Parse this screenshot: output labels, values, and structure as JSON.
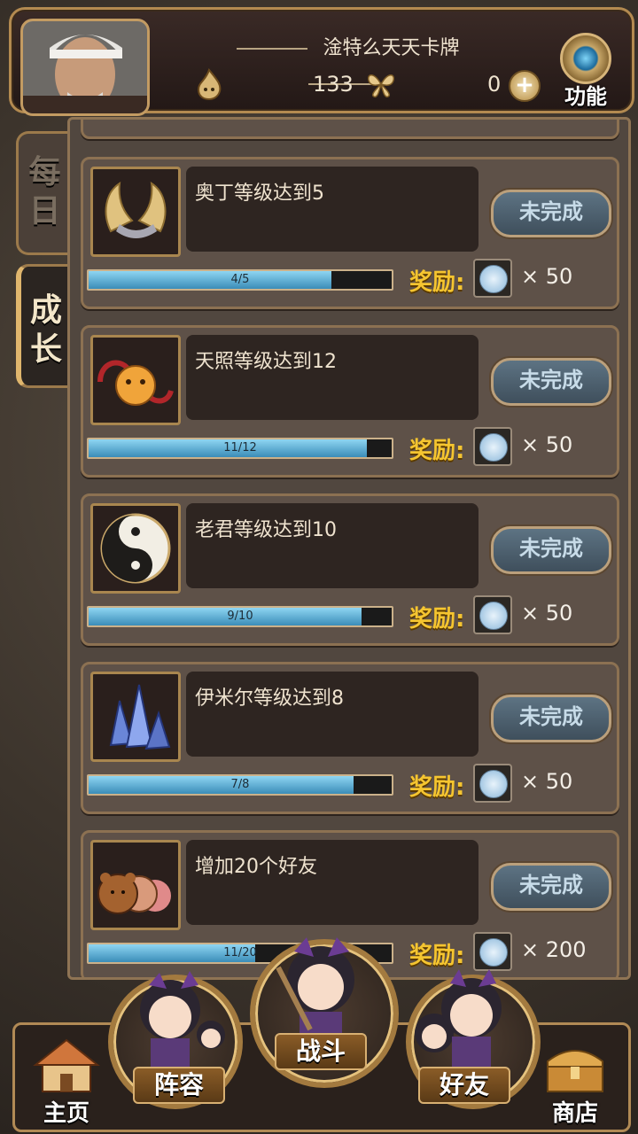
{
  "header": {
    "title": "淦特么天天卡牌",
    "resource1_value": "133",
    "resource2_value": "0",
    "function_label": "功能"
  },
  "tabs": [
    {
      "label_line1": "每",
      "label_line2": "日"
    },
    {
      "label_line1": "成",
      "label_line2": "长"
    }
  ],
  "quests": [
    {
      "title": "奥丁等级达到5",
      "progress_text": "4/5",
      "progress": 0.8,
      "status": "未完成",
      "reward_label": "奖励:",
      "reward_qty": "× 50"
    },
    {
      "title": "天照等级达到12",
      "progress_text": "11/12",
      "progress": 0.917,
      "status": "未完成",
      "reward_label": "奖励:",
      "reward_qty": "× 50"
    },
    {
      "title": "老君等级达到10",
      "progress_text": "9/10",
      "progress": 0.9,
      "status": "未完成",
      "reward_label": "奖励:",
      "reward_qty": "× 50"
    },
    {
      "title": "伊米尔等级达到8",
      "progress_text": "7/8",
      "progress": 0.875,
      "status": "未完成",
      "reward_label": "奖励:",
      "reward_qty": "× 50"
    },
    {
      "title": "增加20个好友",
      "progress_text": "11/20",
      "progress": 0.55,
      "status": "未完成",
      "reward_label": "奖励:",
      "reward_qty": "× 200"
    }
  ],
  "nav": {
    "home": "主页",
    "team": "阵容",
    "battle": "战斗",
    "friends": "好友",
    "shop": "商店"
  },
  "colors": {
    "accent_gold": "#f5c530",
    "progress_fill": "#5ab0d8",
    "frame": "#b38a50"
  }
}
